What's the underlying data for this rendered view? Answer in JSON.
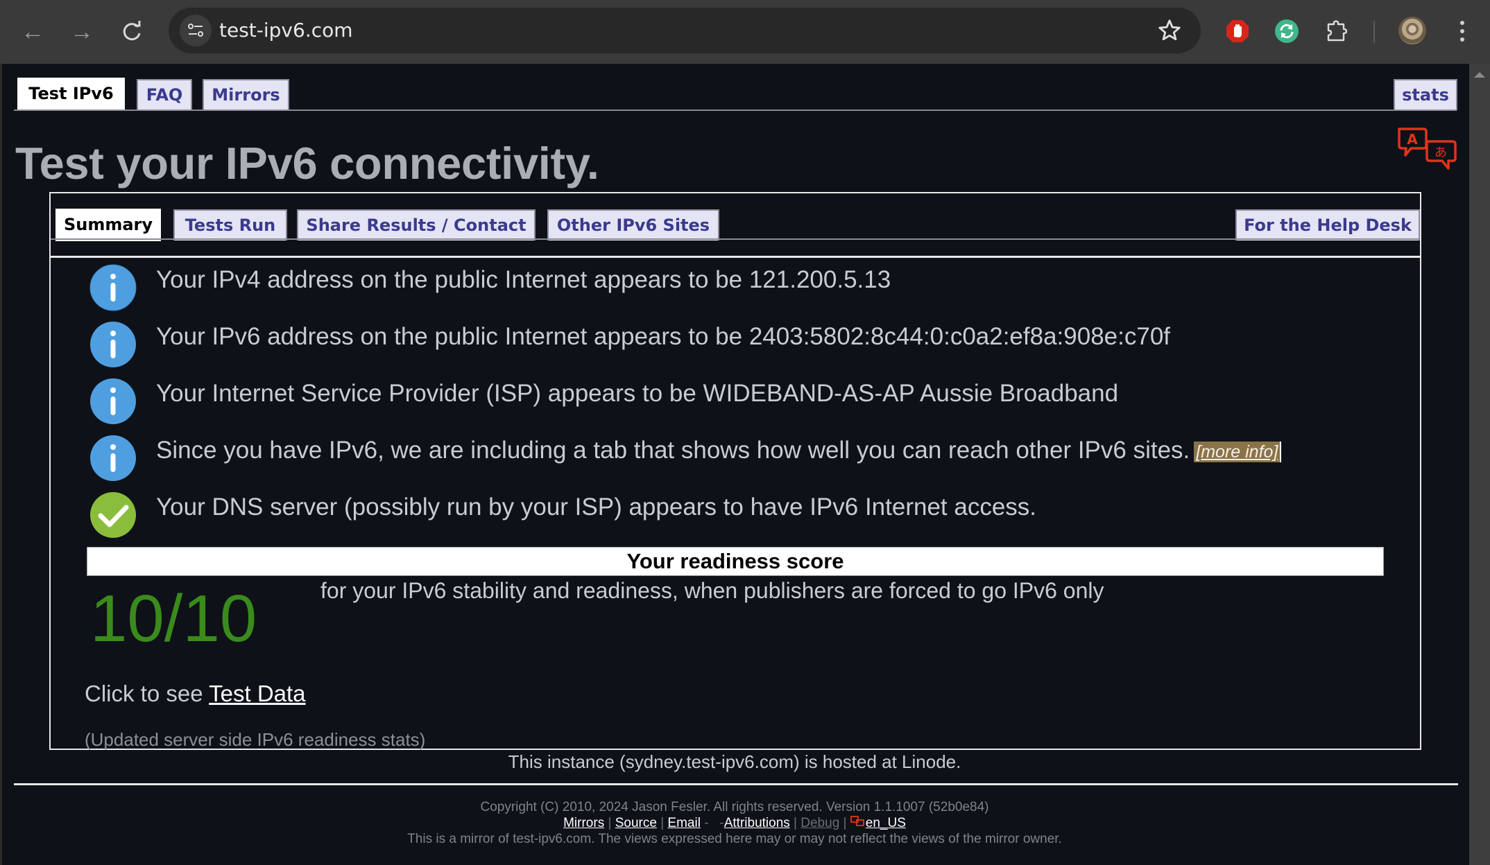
{
  "browser": {
    "url": "test-ipv6.com",
    "icons": [
      "back-arrow-icon",
      "forward-arrow-icon",
      "reload-icon",
      "site-info-icon",
      "bookmark-star-icon",
      "adblock-extension-icon",
      "sync-extension-icon",
      "extensions-puzzle-icon",
      "profile-avatar",
      "menu-kebab-icon"
    ]
  },
  "top_tabs": [
    {
      "label": "Test IPv6",
      "active": true
    },
    {
      "label": "FAQ",
      "active": false
    },
    {
      "label": "Mirrors",
      "active": false
    }
  ],
  "stats_tab": {
    "label": "stats"
  },
  "page_title": "Test your IPv6 connectivity.",
  "sub_tabs": [
    {
      "label": "Summary",
      "active": true
    },
    {
      "label": "Tests Run",
      "active": false
    },
    {
      "label": "Share Results / Contact",
      "active": false
    },
    {
      "label": "Other IPv6 Sites",
      "active": false
    }
  ],
  "help_desk_tab": {
    "label": "For the Help Desk"
  },
  "results": [
    {
      "icon": "info",
      "text": "Your IPv4 address on the public Internet appears to be 121.200.5.13"
    },
    {
      "icon": "info",
      "text": "Your IPv6 address on the public Internet appears to be 2403:5802:8c44:0:c0a2:ef8a:908e:c70f"
    },
    {
      "icon": "info",
      "text": "Your Internet Service Provider (ISP) appears to be WIDEBAND-AS-AP Aussie Broadband"
    },
    {
      "icon": "info",
      "text": "Since you have IPv6, we are including a tab that shows how well you can reach other IPv6 sites.",
      "link": "[more info]"
    },
    {
      "icon": "check",
      "text": "Your DNS server (possibly run by your ISP) appears to have IPv6 Internet access."
    }
  ],
  "readiness": {
    "title": "Your readiness score",
    "score": "10/10",
    "score_value": 10,
    "score_max": 10,
    "description": "for your IPv6 stability and readiness, when publishers are forced to go IPv6 only"
  },
  "test_data": {
    "prefix": "Click to see ",
    "link": "Test Data"
  },
  "updated_stats": "(Updated server side IPv6 readiness stats)",
  "instance_note": "This instance (sydney.test-ipv6.com) is hosted at Linode.",
  "footer": {
    "copyright": "Copyright (C) 2010, 2024 Jason Fesler. All rights reserved. Version 1.1.1007 (52b0e84)",
    "links": {
      "mirrors": "Mirrors",
      "source": "Source",
      "email": "Email",
      "attributions": "Attributions",
      "debug": "Debug",
      "locale": "en_US"
    },
    "sep_pipe": "|",
    "sep_dash": "-",
    "mirror_note": "This is a mirror of test-ipv6.com. The views expressed here may or may not reflect the views of the mirror owner."
  },
  "colors": {
    "page_bg": "#0e1118",
    "tab_bg": "#e4e4f4",
    "tab_text": "#3a3a8e",
    "score_green": "#3a8a1c",
    "info_blue": "#4f9fe0",
    "check_green": "#8bbd3c",
    "translate_red": "#e0341a"
  }
}
